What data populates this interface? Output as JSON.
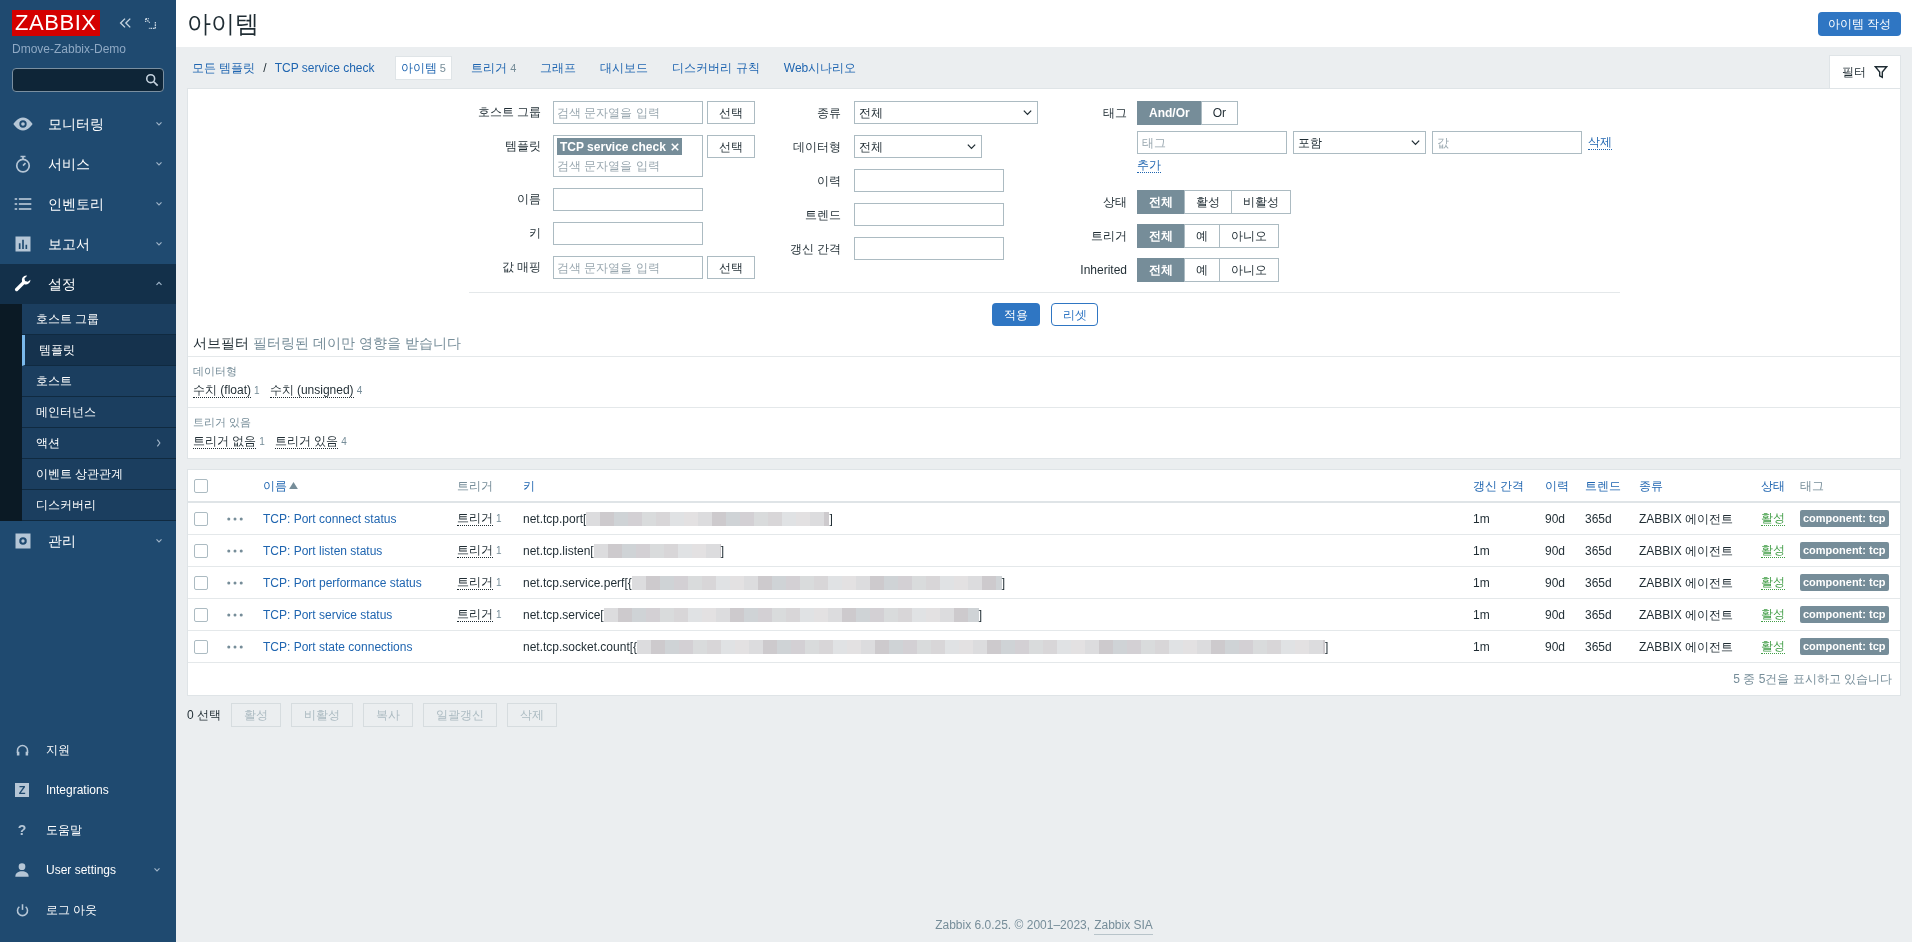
{
  "sidebar": {
    "logo": "ZABBIX",
    "server_name": "Dmove-Zabbix-Demo",
    "menu": [
      {
        "label": "모니터링",
        "expanded": false
      },
      {
        "label": "서비스",
        "expanded": false
      },
      {
        "label": "인벤토리",
        "expanded": false
      },
      {
        "label": "보고서",
        "expanded": false
      },
      {
        "label": "설정",
        "expanded": true,
        "children": [
          {
            "label": "호스트 그룹",
            "selected": false,
            "has_submenu": false
          },
          {
            "label": "템플릿",
            "selected": true,
            "has_submenu": false
          },
          {
            "label": "호스트",
            "selected": false,
            "has_submenu": false
          },
          {
            "label": "메인터넌스",
            "selected": false,
            "has_submenu": false
          },
          {
            "label": "액션",
            "selected": false,
            "has_submenu": true
          },
          {
            "label": "이벤트 상관관계",
            "selected": false,
            "has_submenu": false
          },
          {
            "label": "디스커버리",
            "selected": false,
            "has_submenu": false
          }
        ]
      },
      {
        "label": "관리",
        "expanded": false
      }
    ],
    "bottom_menu": [
      {
        "label": "지원",
        "has_submenu": false
      },
      {
        "label": "Integrations",
        "icon_text": "Z",
        "has_submenu": false
      },
      {
        "label": "도움말",
        "icon_text": "?",
        "has_submenu": false
      },
      {
        "label": "User settings",
        "has_submenu": true
      },
      {
        "label": "로그 아웃",
        "has_submenu": false
      }
    ]
  },
  "page": {
    "title": "아이템",
    "create_button": "아이템 작성"
  },
  "breadcrumbs": [
    {
      "label": "모든 템플릿"
    },
    {
      "label": "TCP service check"
    }
  ],
  "breadcrumb_separator": "/",
  "tabs": [
    {
      "label": "아이템",
      "count": "5",
      "selected": true
    },
    {
      "label": "트리거",
      "count": "4",
      "selected": false
    },
    {
      "label": "그래프",
      "selected": false
    },
    {
      "label": "대시보드",
      "selected": false
    },
    {
      "label": "디스커버리 규칙",
      "selected": false
    },
    {
      "label": "Web시나리오",
      "selected": false
    }
  ],
  "filter_tab": {
    "label": "필터",
    "selected": true
  },
  "filter": {
    "column_1": [
      {
        "label": "호스트 그룹",
        "kind": "multiselect",
        "placeholder": "검색 문자열을 입력",
        "button": "선택"
      },
      {
        "label": "템플릿",
        "kind": "multiselect",
        "chips": [
          "TCP service check"
        ],
        "placeholder": "검색 문자열을 입력",
        "button": "선택"
      },
      {
        "label": "이름",
        "kind": "text"
      },
      {
        "label": "키",
        "kind": "text"
      },
      {
        "label": "값 매핑",
        "kind": "multiselect",
        "placeholder": "검색 문자열을 입력",
        "button": "선택"
      }
    ],
    "column_2": [
      {
        "label": "종류",
        "kind": "select",
        "value": "전체"
      },
      {
        "label": "데이터형",
        "kind": "select",
        "value": "전체"
      },
      {
        "label": "이력",
        "kind": "text"
      },
      {
        "label": "트렌드",
        "kind": "text"
      },
      {
        "label": "갱신 간격",
        "kind": "text"
      }
    ],
    "tags": {
      "label": "태그",
      "operator": [
        {
          "label": "And/Or",
          "selected": true
        },
        {
          "label": "Or",
          "selected": false
        }
      ],
      "row": {
        "tag_placeholder": "태그",
        "condition": "포함",
        "value_placeholder": "값",
        "remove": "삭제"
      },
      "add": "추가"
    },
    "toggles": [
      {
        "label": "상태",
        "options": [
          {
            "label": "전체",
            "selected": true
          },
          {
            "label": "활성",
            "selected": false
          },
          {
            "label": "비활성",
            "selected": false
          }
        ]
      },
      {
        "label": "트리거",
        "options": [
          {
            "label": "전체",
            "selected": true
          },
          {
            "label": "예",
            "selected": false
          },
          {
            "label": "아니오",
            "selected": false
          }
        ]
      },
      {
        "label": "Inherited",
        "options": [
          {
            "label": "전체",
            "selected": true
          },
          {
            "label": "예",
            "selected": false
          },
          {
            "label": "아니오",
            "selected": false
          }
        ]
      }
    ],
    "apply": "적용",
    "reset": "리셋"
  },
  "subfilter": {
    "title": "서브필터",
    "note": "필터링된 데이만 영향을 받습니다",
    "groups": [
      {
        "label": "데이터형",
        "items": [
          {
            "label": "수치 (float)",
            "count": "1"
          },
          {
            "label": "수치 (unsigned)",
            "count": "4"
          }
        ]
      },
      {
        "label": "트리거 있음",
        "items": [
          {
            "label": "트리거 없음",
            "count": "1"
          },
          {
            "label": "트리거 있음",
            "count": "4"
          }
        ]
      }
    ]
  },
  "table": {
    "select_all": {
      "checked": false
    },
    "columns": [
      {
        "label": "이름",
        "sortable": true,
        "sorted": true
      },
      {
        "label": "트리거",
        "sortable": false
      },
      {
        "label": "키",
        "sortable": true
      },
      {
        "label": "갱신 간격",
        "sortable": true
      },
      {
        "label": "이력",
        "sortable": true
      },
      {
        "label": "트렌드",
        "sortable": true
      },
      {
        "label": "종류",
        "sortable": true
      },
      {
        "label": "상태",
        "sortable": true
      },
      {
        "label": "태그",
        "sortable": false
      }
    ],
    "rows": [
      {
        "checked": false,
        "name": "TCP: Port connect status",
        "trigger_label": "트리거",
        "trigger_count": "1",
        "key_prefix": "net.tcp.port[",
        "key_suffix": "]",
        "interval": "1m",
        "history": "90d",
        "trends": "365d",
        "type": "ZABBIX 에이전트",
        "status": "활성",
        "enabled": true,
        "tag": "component: tcp"
      },
      {
        "checked": false,
        "name": "TCP: Port listen status",
        "trigger_label": "트리거",
        "trigger_count": "1",
        "key_prefix": "net.tcp.listen[",
        "key_suffix": "]",
        "interval": "1m",
        "history": "90d",
        "trends": "365d",
        "type": "ZABBIX 에이전트",
        "status": "활성",
        "enabled": true,
        "tag": "component: tcp"
      },
      {
        "checked": false,
        "name": "TCP: Port performance status",
        "trigger_label": "트리거",
        "trigger_count": "1",
        "key_prefix": "net.tcp.service.perf[{",
        "key_suffix": "]",
        "interval": "1m",
        "history": "90d",
        "trends": "365d",
        "type": "ZABBIX 에이전트",
        "status": "활성",
        "enabled": true,
        "tag": "component: tcp"
      },
      {
        "checked": false,
        "name": "TCP: Port service status",
        "trigger_label": "트리거",
        "trigger_count": "1",
        "key_prefix": "net.tcp.service[",
        "key_suffix": "]",
        "interval": "1m",
        "history": "90d",
        "trends": "365d",
        "type": "ZABBIX 에이전트",
        "status": "활성",
        "enabled": true,
        "tag": "component: tcp"
      },
      {
        "checked": false,
        "name": "TCP: Port state connections",
        "key_prefix": "net.tcp.socket.count[{",
        "key_suffix": "]",
        "interval": "1m",
        "history": "90d",
        "trends": "365d",
        "type": "ZABBIX 에이전트",
        "status": "활성",
        "enabled": true,
        "tag": "component: tcp"
      }
    ],
    "summary": "5 중 5건을 표시하고 있습니다"
  },
  "selection": {
    "count_text": "0 선택",
    "buttons": [
      {
        "label": "활성",
        "disabled": true
      },
      {
        "label": "비활성",
        "disabled": true
      },
      {
        "label": "복사",
        "disabled": true
      },
      {
        "label": "일괄갱신",
        "disabled": true
      },
      {
        "label": "삭제",
        "disabled": true
      }
    ]
  },
  "footer": {
    "text": "Zabbix 6.0.25. © 2001–2023,",
    "link": "Zabbix SIA"
  }
}
